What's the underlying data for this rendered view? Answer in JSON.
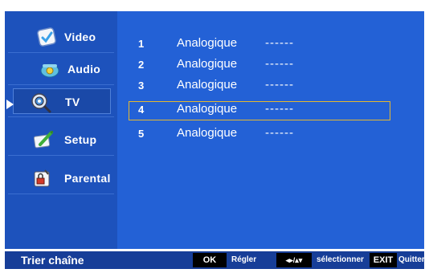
{
  "sidebar": {
    "items": [
      {
        "label": "Video",
        "icon": "video-icon"
      },
      {
        "label": "Audio",
        "icon": "audio-icon"
      },
      {
        "label": "TV",
        "icon": "tv-icon"
      },
      {
        "label": "Setup",
        "icon": "setup-icon"
      },
      {
        "label": "Parental",
        "icon": "parental-icon"
      }
    ],
    "selected": "TV"
  },
  "channels": [
    {
      "number": "1",
      "name": "Analogique",
      "value": "------"
    },
    {
      "number": "2",
      "name": "Analogique",
      "value": "------"
    },
    {
      "number": "3",
      "name": "Analogique",
      "value": "------"
    },
    {
      "number": "4",
      "name": "Analogique",
      "value": "------"
    },
    {
      "number": "5",
      "name": "Analogique",
      "value": "------"
    }
  ],
  "selected_channel": "4",
  "footer": {
    "title": "Trier chaîne",
    "ok_key": "OK",
    "ok_label": "Régler",
    "nav_key": "◆▸/◆",
    "nav_label": "sélectionner",
    "exit_key": "EXIT",
    "exit_label": "Quitter"
  },
  "colors": {
    "sidebar_bg": "#1d52bc",
    "main_bg": "#2361d6",
    "footer_bg": "#173e98",
    "highlight_border": "#e5b830"
  }
}
